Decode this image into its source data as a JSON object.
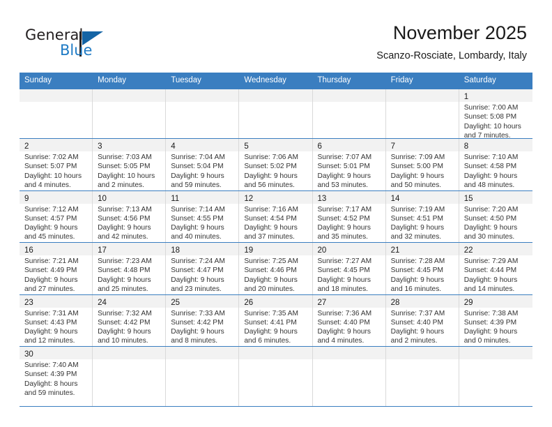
{
  "brand": {
    "name_top": "General",
    "name_bottom": "Blue",
    "accent_color": "#1464a5",
    "text_color": "#231f20"
  },
  "header": {
    "title": "November 2025",
    "subtitle": "Scanzo-Rosciate, Lombardy, Italy"
  },
  "theme": {
    "header_row_bg": "#3a7ec0",
    "header_row_text": "#ffffff",
    "daynum_band_bg": "#f2f2f2",
    "cell_border": "#d9d9d9",
    "row_separator": "#3a7ec0"
  },
  "weekdays": [
    "Sunday",
    "Monday",
    "Tuesday",
    "Wednesday",
    "Thursday",
    "Friday",
    "Saturday"
  ],
  "weeks": [
    [
      {
        "day": "",
        "lines": []
      },
      {
        "day": "",
        "lines": []
      },
      {
        "day": "",
        "lines": []
      },
      {
        "day": "",
        "lines": []
      },
      {
        "day": "",
        "lines": []
      },
      {
        "day": "",
        "lines": []
      },
      {
        "day": "1",
        "lines": [
          "Sunrise: 7:00 AM",
          "Sunset: 5:08 PM",
          "Daylight: 10 hours",
          "and 7 minutes."
        ]
      }
    ],
    [
      {
        "day": "2",
        "lines": [
          "Sunrise: 7:02 AM",
          "Sunset: 5:07 PM",
          "Daylight: 10 hours",
          "and 4 minutes."
        ]
      },
      {
        "day": "3",
        "lines": [
          "Sunrise: 7:03 AM",
          "Sunset: 5:05 PM",
          "Daylight: 10 hours",
          "and 2 minutes."
        ]
      },
      {
        "day": "4",
        "lines": [
          "Sunrise: 7:04 AM",
          "Sunset: 5:04 PM",
          "Daylight: 9 hours",
          "and 59 minutes."
        ]
      },
      {
        "day": "5",
        "lines": [
          "Sunrise: 7:06 AM",
          "Sunset: 5:02 PM",
          "Daylight: 9 hours",
          "and 56 minutes."
        ]
      },
      {
        "day": "6",
        "lines": [
          "Sunrise: 7:07 AM",
          "Sunset: 5:01 PM",
          "Daylight: 9 hours",
          "and 53 minutes."
        ]
      },
      {
        "day": "7",
        "lines": [
          "Sunrise: 7:09 AM",
          "Sunset: 5:00 PM",
          "Daylight: 9 hours",
          "and 50 minutes."
        ]
      },
      {
        "day": "8",
        "lines": [
          "Sunrise: 7:10 AM",
          "Sunset: 4:58 PM",
          "Daylight: 9 hours",
          "and 48 minutes."
        ]
      }
    ],
    [
      {
        "day": "9",
        "lines": [
          "Sunrise: 7:12 AM",
          "Sunset: 4:57 PM",
          "Daylight: 9 hours",
          "and 45 minutes."
        ]
      },
      {
        "day": "10",
        "lines": [
          "Sunrise: 7:13 AM",
          "Sunset: 4:56 PM",
          "Daylight: 9 hours",
          "and 42 minutes."
        ]
      },
      {
        "day": "11",
        "lines": [
          "Sunrise: 7:14 AM",
          "Sunset: 4:55 PM",
          "Daylight: 9 hours",
          "and 40 minutes."
        ]
      },
      {
        "day": "12",
        "lines": [
          "Sunrise: 7:16 AM",
          "Sunset: 4:54 PM",
          "Daylight: 9 hours",
          "and 37 minutes."
        ]
      },
      {
        "day": "13",
        "lines": [
          "Sunrise: 7:17 AM",
          "Sunset: 4:52 PM",
          "Daylight: 9 hours",
          "and 35 minutes."
        ]
      },
      {
        "day": "14",
        "lines": [
          "Sunrise: 7:19 AM",
          "Sunset: 4:51 PM",
          "Daylight: 9 hours",
          "and 32 minutes."
        ]
      },
      {
        "day": "15",
        "lines": [
          "Sunrise: 7:20 AM",
          "Sunset: 4:50 PM",
          "Daylight: 9 hours",
          "and 30 minutes."
        ]
      }
    ],
    [
      {
        "day": "16",
        "lines": [
          "Sunrise: 7:21 AM",
          "Sunset: 4:49 PM",
          "Daylight: 9 hours",
          "and 27 minutes."
        ]
      },
      {
        "day": "17",
        "lines": [
          "Sunrise: 7:23 AM",
          "Sunset: 4:48 PM",
          "Daylight: 9 hours",
          "and 25 minutes."
        ]
      },
      {
        "day": "18",
        "lines": [
          "Sunrise: 7:24 AM",
          "Sunset: 4:47 PM",
          "Daylight: 9 hours",
          "and 23 minutes."
        ]
      },
      {
        "day": "19",
        "lines": [
          "Sunrise: 7:25 AM",
          "Sunset: 4:46 PM",
          "Daylight: 9 hours",
          "and 20 minutes."
        ]
      },
      {
        "day": "20",
        "lines": [
          "Sunrise: 7:27 AM",
          "Sunset: 4:45 PM",
          "Daylight: 9 hours",
          "and 18 minutes."
        ]
      },
      {
        "day": "21",
        "lines": [
          "Sunrise: 7:28 AM",
          "Sunset: 4:45 PM",
          "Daylight: 9 hours",
          "and 16 minutes."
        ]
      },
      {
        "day": "22",
        "lines": [
          "Sunrise: 7:29 AM",
          "Sunset: 4:44 PM",
          "Daylight: 9 hours",
          "and 14 minutes."
        ]
      }
    ],
    [
      {
        "day": "23",
        "lines": [
          "Sunrise: 7:31 AM",
          "Sunset: 4:43 PM",
          "Daylight: 9 hours",
          "and 12 minutes."
        ]
      },
      {
        "day": "24",
        "lines": [
          "Sunrise: 7:32 AM",
          "Sunset: 4:42 PM",
          "Daylight: 9 hours",
          "and 10 minutes."
        ]
      },
      {
        "day": "25",
        "lines": [
          "Sunrise: 7:33 AM",
          "Sunset: 4:42 PM",
          "Daylight: 9 hours",
          "and 8 minutes."
        ]
      },
      {
        "day": "26",
        "lines": [
          "Sunrise: 7:35 AM",
          "Sunset: 4:41 PM",
          "Daylight: 9 hours",
          "and 6 minutes."
        ]
      },
      {
        "day": "27",
        "lines": [
          "Sunrise: 7:36 AM",
          "Sunset: 4:40 PM",
          "Daylight: 9 hours",
          "and 4 minutes."
        ]
      },
      {
        "day": "28",
        "lines": [
          "Sunrise: 7:37 AM",
          "Sunset: 4:40 PM",
          "Daylight: 9 hours",
          "and 2 minutes."
        ]
      },
      {
        "day": "29",
        "lines": [
          "Sunrise: 7:38 AM",
          "Sunset: 4:39 PM",
          "Daylight: 9 hours",
          "and 0 minutes."
        ]
      }
    ],
    [
      {
        "day": "30",
        "lines": [
          "Sunrise: 7:40 AM",
          "Sunset: 4:39 PM",
          "Daylight: 8 hours",
          "and 59 minutes."
        ]
      },
      {
        "day": "",
        "lines": []
      },
      {
        "day": "",
        "lines": []
      },
      {
        "day": "",
        "lines": []
      },
      {
        "day": "",
        "lines": []
      },
      {
        "day": "",
        "lines": []
      },
      {
        "day": "",
        "lines": []
      }
    ]
  ]
}
